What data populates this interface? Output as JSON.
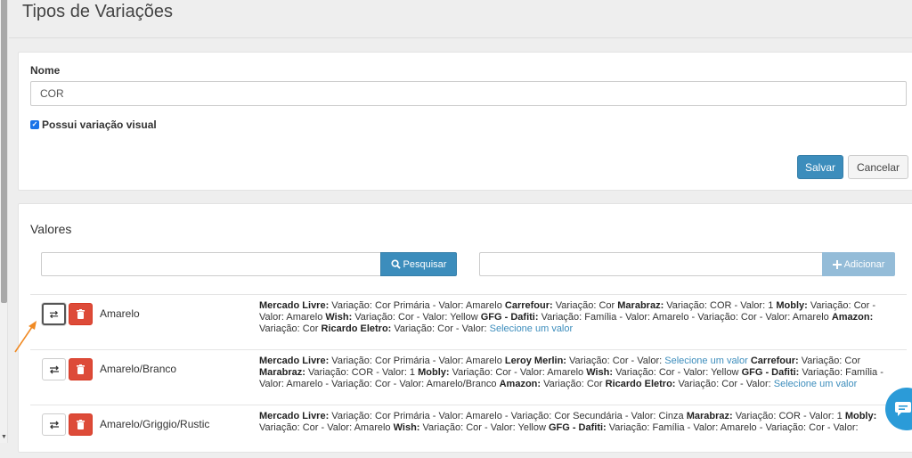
{
  "page": {
    "title": "Tipos de Variações"
  },
  "form": {
    "name_label": "Nome",
    "name_value": "COR",
    "visual_variation_label": "Possui variação visual",
    "visual_variation_checked": true,
    "save_label": "Salvar",
    "cancel_label": "Cancelar"
  },
  "values": {
    "title": "Valores",
    "search_label": "Pesquisar",
    "add_label": "Adicionar",
    "rows": [
      {
        "name": "Amarelo",
        "desc": [
          {
            "b": "Mercado Livre:"
          },
          {
            "t": " Variação: Cor Primária - Valor: Amarelo "
          },
          {
            "b": "Carrefour:"
          },
          {
            "t": " Variação: Cor "
          },
          {
            "b": "Marabraz:"
          },
          {
            "t": " Variação: COR - Valor: 1 "
          },
          {
            "b": "Mobly:"
          },
          {
            "t": " Variação: Cor - Valor: Amarelo "
          },
          {
            "b": "Wish:"
          },
          {
            "t": " Variação: Cor - Valor: Yellow "
          },
          {
            "b": "GFG - Dafiti:"
          },
          {
            "t": " Variação: Família - Valor: Amarelo - Variação: Cor - Valor: Amarelo "
          },
          {
            "b": "Amazon:"
          },
          {
            "t": " Variação: Cor "
          },
          {
            "b": "Ricardo Eletro:"
          },
          {
            "t": " Variação: Cor - Valor: "
          },
          {
            "l": "Selecione um valor"
          }
        ]
      },
      {
        "name": "Amarelo/Branco",
        "desc": [
          {
            "b": "Mercado Livre:"
          },
          {
            "t": " Variação: Cor Primária - Valor: Amarelo "
          },
          {
            "b": "Leroy Merlin:"
          },
          {
            "t": " Variação: Cor - Valor: "
          },
          {
            "l": "Selecione um valor"
          },
          {
            "t": " "
          },
          {
            "b": "Carrefour:"
          },
          {
            "t": " Variação: Cor "
          },
          {
            "b": "Marabraz:"
          },
          {
            "t": " Variação: COR - Valor: 1 "
          },
          {
            "b": "Mobly:"
          },
          {
            "t": " Variação: Cor - Valor: Amarelo "
          },
          {
            "b": "Wish:"
          },
          {
            "t": " Variação: Cor - Valor: Yellow "
          },
          {
            "b": "GFG - Dafiti:"
          },
          {
            "t": " Variação: Família - Valor: Amarelo - Variação: Cor - Valor: Amarelo/Branco "
          },
          {
            "b": "Amazon:"
          },
          {
            "t": " Variação: Cor "
          },
          {
            "b": "Ricardo Eletro:"
          },
          {
            "t": " Variação: Cor - Valor: "
          },
          {
            "l": "Selecione um valor"
          }
        ]
      },
      {
        "name": "Amarelo/Griggio/Rustic",
        "desc": [
          {
            "b": "Mercado Livre:"
          },
          {
            "t": " Variação: Cor Primária - Valor: Amarelo - Variação: Cor Secundária - Valor: Cinza "
          },
          {
            "b": "Marabraz:"
          },
          {
            "t": " Variação: COR - Valor: 1 "
          },
          {
            "b": "Mobly:"
          },
          {
            "t": " Variação: Cor - Valor: Amarelo "
          },
          {
            "b": "Wish:"
          },
          {
            "t": " Variação: Cor - Valor: Yellow "
          },
          {
            "b": "GFG - Dafiti:"
          },
          {
            "t": " Variação: Família - Valor: Amarelo - Variação: Cor - Valor:"
          }
        ]
      }
    ]
  },
  "colors": {
    "primary": "#3c8dbc",
    "danger": "#dd4b39",
    "add_disabled": "#94bcd8",
    "annotation_arrow": "#f08a24",
    "chat": "#2b9bd8"
  },
  "icons": {
    "search": "search-icon",
    "plus": "plus-icon",
    "swap": "swap-arrows-icon",
    "trash": "trash-icon",
    "chat": "chat-icon"
  }
}
